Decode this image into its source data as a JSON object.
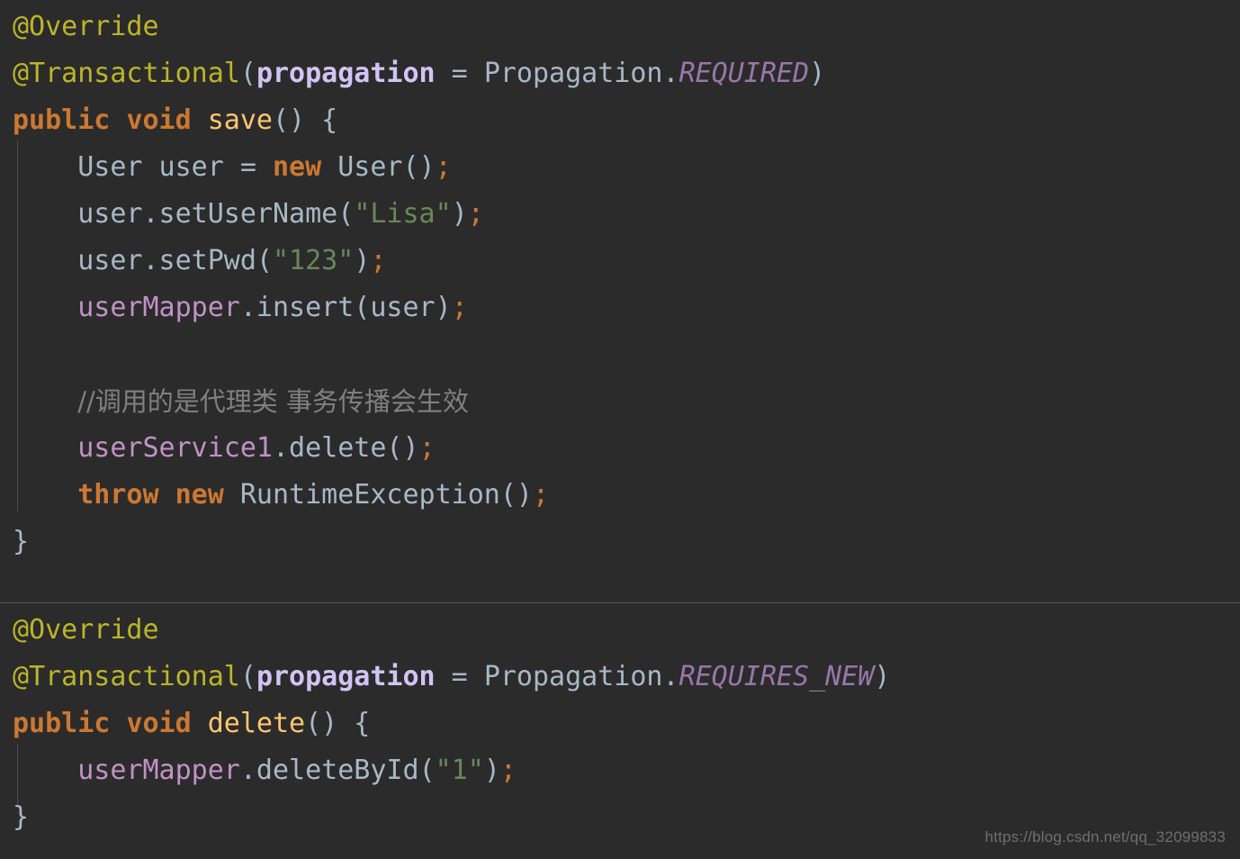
{
  "editor": {
    "theme_name": "darcula",
    "background_color": "#2b2b2b",
    "default_text_color": "#a9b7c6",
    "indent_guide_color": "#4b4b4b",
    "divider_color": "#555555",
    "language": "Java"
  },
  "colors": {
    "annotation": "#bbb529",
    "keyword": "#cc7832",
    "method_declaration": "#ffc66d",
    "parameter": "#cfc5f5",
    "static_final_field": "#9876aa",
    "instance_field": "#c191c6",
    "string": "#6a8759",
    "comment": "#808080",
    "default": "#a9b7c6"
  },
  "blocks": [
    {
      "id": "save-method",
      "name": "save",
      "annotations": [
        "@Override",
        "@Transactional(propagation = Propagation.REQUIRED)"
      ],
      "signature": "public void save() {",
      "propagation_value": "REQUIRED",
      "lines": [
        "@Override",
        "@Transactional(propagation = Propagation.REQUIRED)",
        "public void save() {",
        "    User user = new User();",
        "    user.setUserName(\"Lisa\");",
        "    user.setPwd(\"123\");",
        "    userMapper.insert(user);",
        "",
        "    //调用的是代理类 事务传播会生效",
        "    userService1.delete();",
        "    throw new RuntimeException();",
        "}"
      ]
    },
    {
      "id": "delete-method",
      "name": "delete",
      "annotations": [
        "@Override",
        "@Transactional(propagation = Propagation.REQUIRES_NEW)"
      ],
      "signature": "public void delete() {",
      "propagation_value": "REQUIRES_NEW",
      "lines": [
        "@Override",
        "@Transactional(propagation = Propagation.REQUIRES_NEW)",
        "public void delete() {",
        "    userMapper.deleteById(\"1\");",
        "}"
      ]
    }
  ],
  "tokens": {
    "at": "@",
    "override": "Override",
    "transactional": "Transactional",
    "paren_open": "(",
    "paren_close": ")",
    "paren_pair": "()",
    "propagation_param": "propagation",
    "equals": " = ",
    "propagation_class": "Propagation",
    "dot": ".",
    "required": "REQUIRED",
    "requires_new": "REQUIRES_NEW",
    "public": "public",
    "void": "void",
    "space": " ",
    "save": "save",
    "delete_name": "delete",
    "brace_open": " {",
    "brace_close": "}",
    "indent": "    ",
    "user_class": "User",
    "user_var": " user = ",
    "new": "new",
    "user_ctor": " User()",
    "semi": ";",
    "user_dot": "user",
    "set_user_name": ".setUserName(",
    "str_lisa": "\"Lisa\"",
    "set_pwd": ".setPwd(",
    "str_123": "\"123\"",
    "user_mapper": "userMapper",
    "insert": ".insert(user)",
    "comment_cn": "//调用的是代理类 事务传播会生效",
    "user_service1": "userService1",
    "delete_call": ".delete()",
    "throw": "throw",
    "runtime_exception": " RuntimeException()",
    "delete_by_id": ".deleteById(",
    "str_1": "\"1\""
  },
  "watermark": {
    "text": "https://blog.csdn.net/qq_32099833"
  }
}
